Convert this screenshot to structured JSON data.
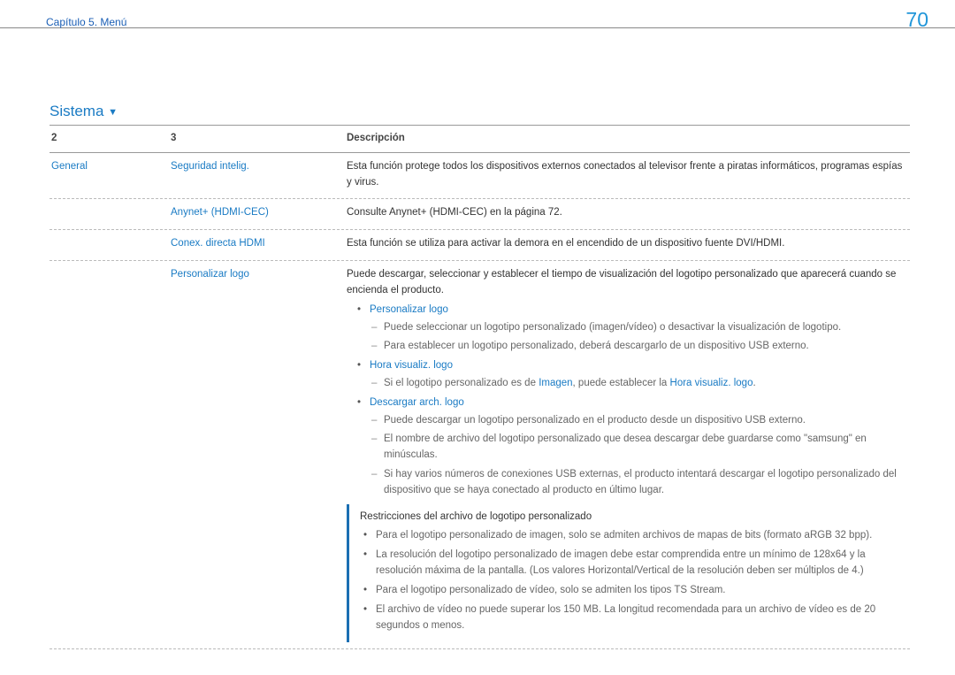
{
  "header": {
    "chapter": "Capítulo 5. Menú",
    "page_number": "70"
  },
  "section": {
    "title": "Sistema"
  },
  "table": {
    "headers": {
      "c1": "2",
      "c2": "3",
      "c3": "Descripción"
    },
    "col1_label": "General",
    "rows": [
      {
        "label": "Seguridad intelig.",
        "text": "Esta función protege todos los dispositivos externos conectados al televisor frente a piratas informáticos, programas espías y virus."
      },
      {
        "label": "Anynet+ (HDMI-CEC)",
        "text": "Consulte Anynet+ (HDMI-CEC) en la página 72."
      },
      {
        "label": "Conex. directa HDMI",
        "text": "Esta función se utiliza para activar la demora en el encendido de un dispositivo fuente DVI/HDMI."
      }
    ],
    "logo_row": {
      "label": "Personalizar logo",
      "intro": "Puede descargar, seleccionar y establecer el tiempo de visualización del logotipo personalizado que aparecerá cuando se encienda el producto.",
      "personalizar": {
        "title": "Personalizar logo",
        "d1": "Puede seleccionar un logotipo personalizado (imagen/vídeo) o desactivar la visualización de logotipo.",
        "d2": "Para establecer un logotipo personalizado, deberá descargarlo de un dispositivo USB externo."
      },
      "hora": {
        "title": "Hora visualiz. logo",
        "d1_pre": "Si el logotipo personalizado es de ",
        "d1_imagen": "Imagen",
        "d1_mid": ", puede establecer la ",
        "d1_bold": "Hora visualiz. logo",
        "d1_post": "."
      },
      "descargar": {
        "title": "Descargar arch. logo",
        "d1": "Puede descargar un logotipo personalizado en el producto desde un dispositivo USB externo.",
        "d2": "El nombre de archivo del logotipo personalizado que desea descargar debe guardarse como \"samsung\" en minúsculas.",
        "d3": "Si hay varios números de conexiones USB externas, el producto intentará descargar el logotipo personalizado del dispositivo que se haya conectado al producto en último lugar."
      },
      "restrictions": {
        "title": "Restricciones del archivo de logotipo personalizado",
        "r1": "Para el logotipo personalizado de imagen, solo se admiten archivos de mapas de bits (formato aRGB 32 bpp).",
        "r2": "La resolución del logotipo personalizado de imagen debe estar comprendida entre un mínimo de 128x64 y la resolución máxima de la pantalla. (Los valores Horizontal/Vertical de la resolución deben ser múltiplos de 4.)",
        "r3": "Para el logotipo personalizado de vídeo, solo se admiten los tipos TS Stream.",
        "r4": "El archivo de vídeo no puede superar los 150 MB. La longitud recomendada para un archivo de vídeo es de 20 segundos o menos."
      }
    }
  }
}
